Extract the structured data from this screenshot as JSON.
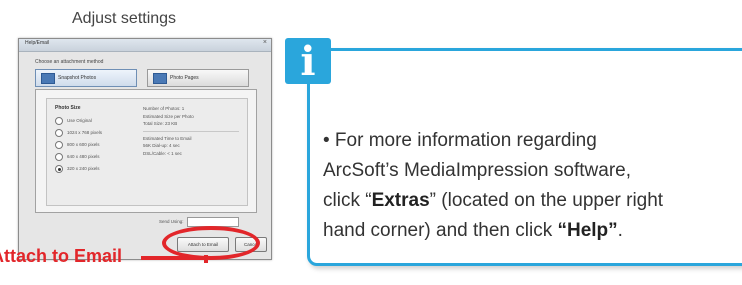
{
  "caption": "Adjust settings",
  "dialog": {
    "title": "Help/Email",
    "close_symbol": "×",
    "heading": "Choose an attachment method",
    "tabs": [
      {
        "label": "Snapshot Photos",
        "selected": true
      },
      {
        "label": "Photo Pages",
        "selected": false
      }
    ],
    "sizes_heading": "Photo Size",
    "sizes": [
      {
        "label": "Use Original",
        "selected": false
      },
      {
        "label": "1024 x 768 pixels",
        "selected": false
      },
      {
        "label": "800 x 600 pixels",
        "selected": false
      },
      {
        "label": "640 x 480 pixels",
        "selected": false
      },
      {
        "label": "320 x 240 pixels",
        "selected": true
      }
    ],
    "info_lines_top": [
      "Number of Photos: 1",
      "Estimated Size per Photo",
      "Total Size: 23 KB"
    ],
    "info_lines_bottom": [
      "Estimated Time to Email",
      "56K Dial-up: 4 sec",
      "DSL/Cable: < 1 sec"
    ],
    "bottom_label": "Send Using:",
    "attach_button": "Attach to Email",
    "cancel_button": "Cancel"
  },
  "callout_label": "Attach to Email",
  "info": {
    "badge": "i",
    "line1": "• For more information regarding",
    "line2": "ArcSoft’s MediaImpression software,",
    "line3_pre": "click “",
    "line3_bold": "Extras",
    "line3_post": "” (located on the upper right",
    "line4_pre": "hand corner) and then  click ",
    "line4_bold": "“Help”",
    "line4_post": "."
  },
  "colors": {
    "accent_blue": "#2aa6dc",
    "annotation_red": "#e2262a"
  }
}
